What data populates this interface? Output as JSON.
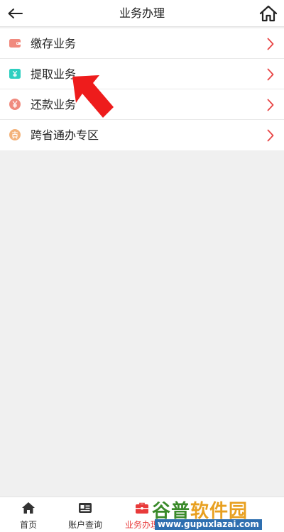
{
  "header": {
    "title": "业务办理",
    "back_icon": "arrow-left-icon",
    "home_icon": "home-icon"
  },
  "menu": {
    "items": [
      {
        "label": "缴存业务",
        "icon": "wallet-icon",
        "color": "#f08a7e"
      },
      {
        "label": "提取业务",
        "icon": "yen-card-icon",
        "color": "#2ecfc0"
      },
      {
        "label": "还款业务",
        "icon": "yen-circle-icon",
        "color": "#f08a7e"
      },
      {
        "label": "跨省通办专区",
        "icon": "loan-circle-icon",
        "color": "#f3b27a"
      }
    ],
    "chevron_color": "#e84545"
  },
  "pointer": {
    "color": "#ee1c1c"
  },
  "tabbar": {
    "tabs": [
      {
        "label": "首页",
        "icon": "home-fill-icon",
        "active": false
      },
      {
        "label": "账户查询",
        "icon": "id-card-icon",
        "active": false
      },
      {
        "label": "业务办理",
        "icon": "briefcase-icon",
        "active": true
      },
      {
        "label": "",
        "icon": "",
        "active": false
      },
      {
        "label": "",
        "icon": "",
        "active": false
      }
    ],
    "active_color": "#e83a3a"
  },
  "watermark": {
    "brand_g": "谷普",
    "brand_o": "软件园",
    "url": "www.gupuxlazai.com"
  }
}
